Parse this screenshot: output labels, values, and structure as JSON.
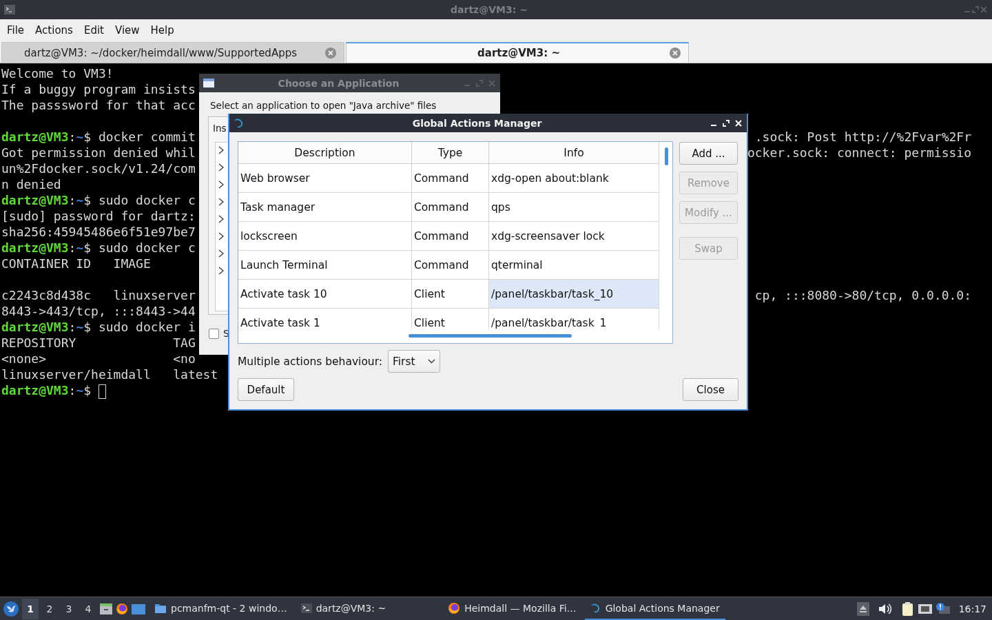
{
  "window": {
    "title": "dartz@VM3: ~"
  },
  "menu": [
    "File",
    "Actions",
    "Edit",
    "View",
    "Help"
  ],
  "tabs": [
    {
      "label": "dartz@VM3: ~/docker/heimdall/www/SupportedApps",
      "selected": false
    },
    {
      "label": "dartz@VM3: ~",
      "selected": true
    }
  ],
  "terminal": {
    "lines": [
      {
        "kind": "text",
        "segments": [
          {
            "kind": "plain",
            "text": "Welcome to VM3!"
          }
        ]
      },
      {
        "kind": "text",
        "segments": [
          {
            "kind": "plain",
            "text": "If a buggy program insists"
          }
        ]
      },
      {
        "kind": "text",
        "segments": [
          {
            "kind": "plain",
            "text": "The passsword for that acc"
          }
        ]
      },
      {
        "kind": "blank"
      },
      {
        "kind": "text",
        "segments": [
          {
            "kind": "user",
            "text": "dartz@VM3"
          },
          {
            "kind": "plain",
            "text": ":"
          },
          {
            "kind": "path",
            "text": "~"
          },
          {
            "kind": "plain",
            "text": "$ docker commit"
          }
        ],
        "right": ".sock: Post http://%2Fvar%2Fr"
      },
      {
        "kind": "text",
        "segments": [
          {
            "kind": "plain",
            "text": "Got permission denied whil"
          }
        ],
        "right": "ocker.sock: connect: permissio"
      },
      {
        "kind": "text",
        "segments": [
          {
            "kind": "plain",
            "text": "un%2Fdocker.sock/v1.24/com"
          }
        ]
      },
      {
        "kind": "text",
        "segments": [
          {
            "kind": "plain",
            "text": "n denied"
          }
        ]
      },
      {
        "kind": "text",
        "segments": [
          {
            "kind": "user",
            "text": "dartz@VM3"
          },
          {
            "kind": "plain",
            "text": ":"
          },
          {
            "kind": "path",
            "text": "~"
          },
          {
            "kind": "plain",
            "text": "$ sudo docker c"
          }
        ]
      },
      {
        "kind": "text",
        "segments": [
          {
            "kind": "plain",
            "text": "[sudo] password for dartz:"
          }
        ]
      },
      {
        "kind": "text",
        "segments": [
          {
            "kind": "plain",
            "text": "sha256:45945486e6f51e97be7"
          }
        ]
      },
      {
        "kind": "text",
        "segments": [
          {
            "kind": "user",
            "text": "dartz@VM3"
          },
          {
            "kind": "plain",
            "text": ":"
          },
          {
            "kind": "path",
            "text": "~"
          },
          {
            "kind": "plain",
            "text": "$ sudo docker c"
          }
        ]
      },
      {
        "kind": "text",
        "segments": [
          {
            "kind": "plain",
            "text": "CONTAINER ID   IMAGE"
          }
        ]
      },
      {
        "kind": "blank"
      },
      {
        "kind": "text",
        "segments": [
          {
            "kind": "plain",
            "text": "c2243c8d438c   linuxserver"
          }
        ],
        "right": "cp, :::8080->80/tcp, 0.0.0.0:"
      },
      {
        "kind": "text",
        "segments": [
          {
            "kind": "plain",
            "text": "8443->443/tcp, :::8443->44"
          }
        ]
      },
      {
        "kind": "text",
        "segments": [
          {
            "kind": "user",
            "text": "dartz@VM3"
          },
          {
            "kind": "plain",
            "text": ":"
          },
          {
            "kind": "path",
            "text": "~"
          },
          {
            "kind": "plain",
            "text": "$ sudo docker i"
          }
        ]
      },
      {
        "kind": "text",
        "segments": [
          {
            "kind": "plain",
            "text": "REPOSITORY             TAG"
          }
        ]
      },
      {
        "kind": "text",
        "segments": [
          {
            "kind": "plain",
            "text": "<none>                 <no"
          }
        ]
      },
      {
        "kind": "text",
        "segments": [
          {
            "kind": "plain",
            "text": "linuxserver/heimdall   latest"
          }
        ]
      },
      {
        "kind": "text",
        "segments": [
          {
            "kind": "user",
            "text": "dartz@VM3"
          },
          {
            "kind": "plain",
            "text": ":"
          },
          {
            "kind": "path",
            "text": "~"
          },
          {
            "kind": "plain",
            "text": "$ "
          }
        ],
        "cursor": true
      }
    ]
  },
  "choose_dialog": {
    "title": "Choose an Application",
    "prompt": "Select an application to open \"Java archive\" files",
    "tab": "Ins",
    "tree_items": [
      {
        "expanded": false
      },
      {
        "expanded": false
      },
      {
        "expanded": false
      },
      {
        "expanded": false
      },
      {
        "expanded": false
      },
      {
        "expanded": false
      },
      {
        "expanded": false
      },
      {
        "expanded": false
      }
    ],
    "checkbox": {
      "label": "S",
      "checked": false
    }
  },
  "actions_dialog": {
    "title": "Global Actions Manager",
    "columns": [
      "Description",
      "Type",
      "Info"
    ],
    "rows": [
      {
        "description": "Web browser",
        "type": "Command",
        "info": "xdg-open about:blank",
        "selected": false
      },
      {
        "description": "Task manager",
        "type": "Command",
        "info": "qps",
        "selected": false
      },
      {
        "description": "lockscreen",
        "type": "Command",
        "info": "xdg-screensaver lock",
        "selected": false
      },
      {
        "description": "Launch Terminal",
        "type": "Command",
        "info": "qterminal",
        "selected": false
      },
      {
        "description": "Activate task 10",
        "type": "Client",
        "info": "/panel/taskbar/task_10",
        "selected": true
      },
      {
        "description": "Activate task 1",
        "type": "Client",
        "info": "/panel/taskbar/task_1",
        "selected": false
      }
    ],
    "button_groups": [
      [
        {
          "label": "Add ...",
          "disabled": false
        },
        {
          "label": "Remove",
          "disabled": true
        },
        {
          "label": "Modify ...",
          "disabled": true
        }
      ],
      [
        {
          "label": "Swap",
          "disabled": true
        }
      ]
    ],
    "behaviour": {
      "label": "Multiple actions behaviour:",
      "value": "First"
    },
    "footer_buttons": [
      "Default",
      "Close"
    ]
  },
  "taskbar": {
    "workspaces": [
      {
        "label": "1",
        "selected": true
      },
      {
        "label": "2",
        "selected": false
      },
      {
        "label": "3",
        "selected": false
      },
      {
        "label": "4",
        "selected": false
      }
    ],
    "tasks": [
      {
        "kind": "folder",
        "label": "pcmanfm-qt - 2 windo…",
        "selected": false
      },
      {
        "kind": "terminal",
        "label": "dartz@VM3: ~",
        "selected": false
      },
      {
        "kind": "firefox",
        "label": "Heimdall — Mozilla Fi…",
        "selected": false
      },
      {
        "kind": "actions",
        "label": "Global Actions Manager",
        "selected": true
      }
    ],
    "clock": "16:17"
  }
}
